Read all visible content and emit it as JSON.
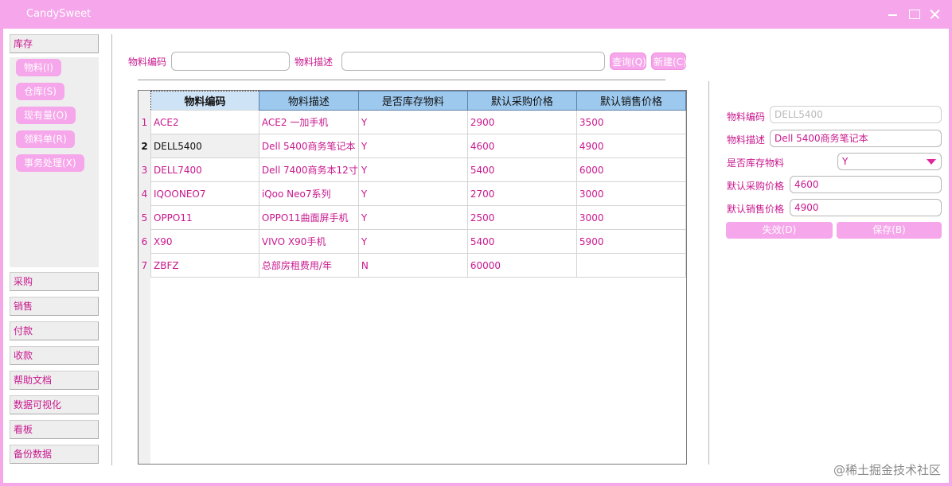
{
  "window": {
    "title": "CandySweet",
    "colors": {
      "accent": "#f6a6ea",
      "text_accent": "#c8188e",
      "header_blue": "#9ec9ee"
    }
  },
  "sidebar": {
    "inventory_label": "库存",
    "sub_items": [
      "物料(I)",
      "仓库(S)",
      "现有量(O)",
      "领料单(R)",
      "事务处理(X)"
    ],
    "modules": [
      "采购",
      "销售",
      "付款",
      "收款",
      "帮助文档",
      "数据可视化",
      "看板",
      "备份数据"
    ]
  },
  "search": {
    "code_label": "物料编码",
    "code_value": "",
    "desc_label": "物料描述",
    "desc_value": "",
    "query_button": "查询(Q)",
    "new_button": "新建(C)"
  },
  "table": {
    "columns": [
      "物料编码",
      "物料描述",
      "是否库存物料",
      "默认采购价格",
      "默认销售价格"
    ],
    "rows": [
      {
        "no": "1",
        "code": "ACE2",
        "desc": "ACE2 一加手机",
        "stock": "Y",
        "buy": "2900",
        "sell": "3500"
      },
      {
        "no": "2",
        "code": "DELL5400",
        "desc": "Dell 5400商务笔记本",
        "stock": "Y",
        "buy": "4600",
        "sell": "4900"
      },
      {
        "no": "3",
        "code": "DELL7400",
        "desc": "Dell 7400商务本12寸",
        "stock": "Y",
        "buy": "5400",
        "sell": "6000"
      },
      {
        "no": "4",
        "code": "IQOONEO7",
        "desc": "iQoo Neo7系列",
        "stock": "Y",
        "buy": "2700",
        "sell": "3000"
      },
      {
        "no": "5",
        "code": "OPPO11",
        "desc": "OPPO11曲面屏手机",
        "stock": "Y",
        "buy": "2500",
        "sell": "3000"
      },
      {
        "no": "6",
        "code": "X90",
        "desc": "VIVO X90手机",
        "stock": "Y",
        "buy": "5400",
        "sell": "5900"
      },
      {
        "no": "7",
        "code": "ZBFZ",
        "desc": "总部房租费用/年",
        "stock": "N",
        "buy": "60000",
        "sell": ""
      }
    ]
  },
  "detail": {
    "code_label": "物料编码",
    "code_value": "DELL5400",
    "desc_label": "物料描述",
    "desc_value": "Dell 5400商务笔记本",
    "stock_label": "是否库存物料",
    "stock_value": "Y",
    "buy_label": "默认采购价格",
    "buy_value": "4600",
    "sell_label": "默认销售价格",
    "sell_value": "4900",
    "disable_button": "失效(D)",
    "save_button": "保存(B)"
  },
  "watermark": "@稀土掘金技术社区"
}
